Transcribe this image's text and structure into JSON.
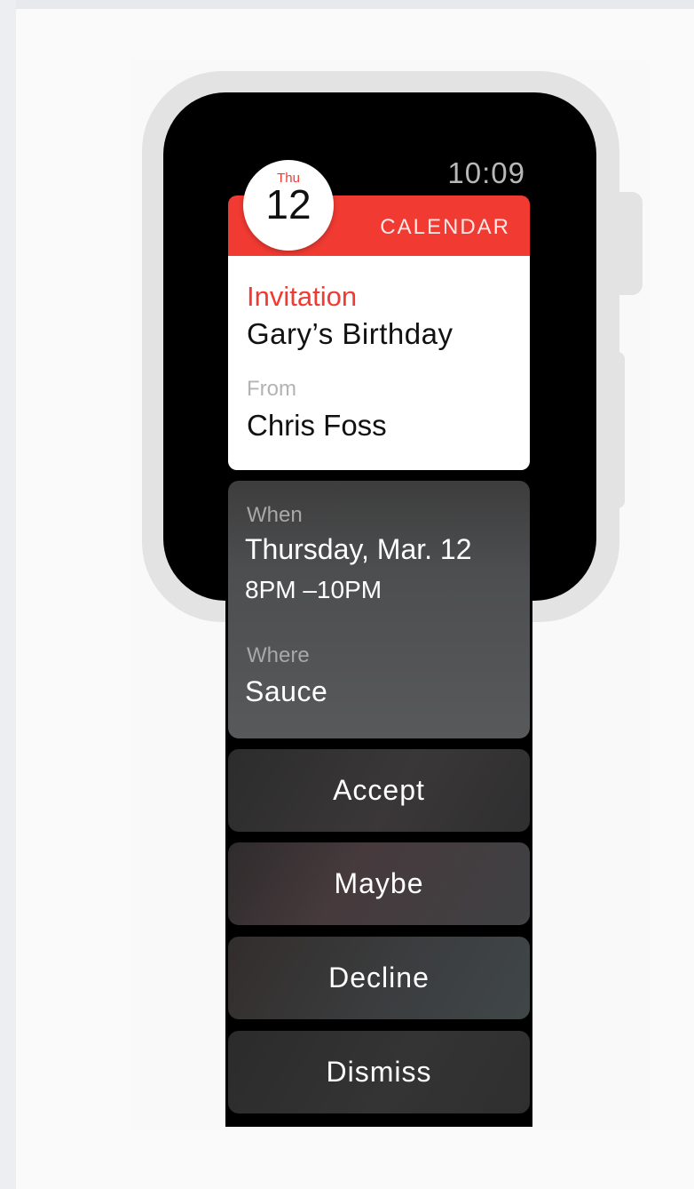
{
  "status": {
    "time": "10:09"
  },
  "notification": {
    "app_name": "CALENDAR",
    "icon": {
      "name": "calendar-icon",
      "day": "Thu",
      "date": "12"
    },
    "title": "Invitation",
    "event": "Gary’s Birthday",
    "from_label": "From",
    "from_value": "Chris Foss"
  },
  "details": {
    "when_label": "When",
    "when_date": "Thursday, Mar. 12",
    "when_time": "8PM –10PM",
    "where_label": "Where",
    "where_value": "Sauce"
  },
  "actions": [
    "Accept",
    "Maybe",
    "Decline",
    "Dismiss"
  ],
  "colors": {
    "accent": "#f03a32",
    "case": "#e3e3e3",
    "screen": "#000000"
  }
}
